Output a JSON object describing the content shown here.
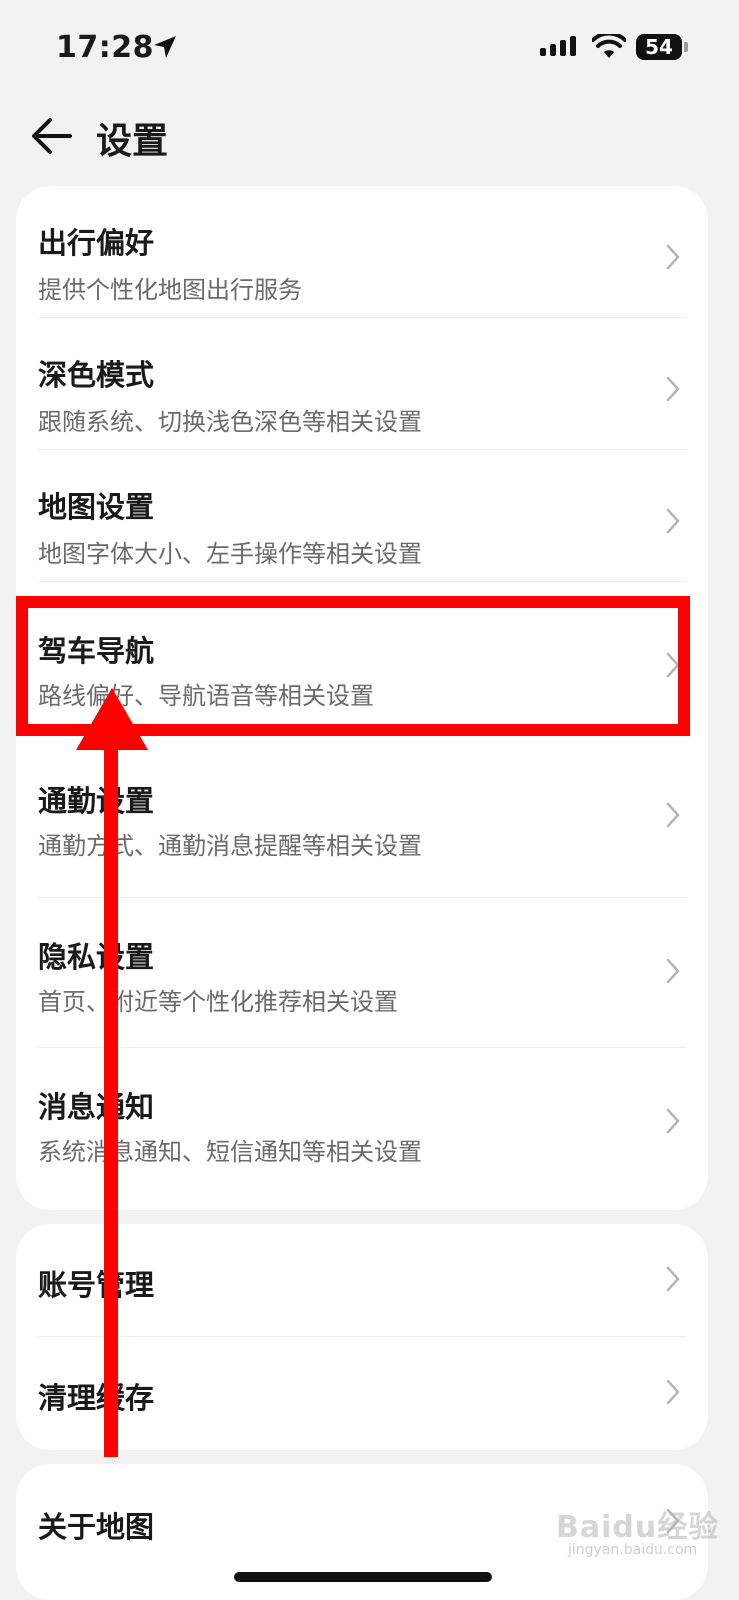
{
  "status_bar": {
    "time": "17:28",
    "battery": "54",
    "location_icon": "location-arrow-icon",
    "signal_icon": "cellular-signal-icon",
    "wifi_icon": "wifi-icon"
  },
  "header": {
    "title": "设置",
    "back_icon": "back-arrow-icon"
  },
  "groups": [
    {
      "items": [
        {
          "title": "出行偏好",
          "subtitle": "提供个性化地图出行服务"
        },
        {
          "title": "深色模式",
          "subtitle": "跟随系统、切换浅色深色等相关设置"
        },
        {
          "title": "地图设置",
          "subtitle": "地图字体大小、左手操作等相关设置"
        },
        {
          "title": "驾车导航",
          "subtitle": "路线偏好、导航语音等相关设置"
        },
        {
          "title": "通勤设置",
          "subtitle": "通勤方式、通勤消息提醒等相关设置"
        },
        {
          "title": "隐私设置",
          "subtitle": "首页、附近等个性化推荐相关设置"
        },
        {
          "title": "消息通知",
          "subtitle": "系统消息通知、短信通知等相关设置"
        }
      ]
    },
    {
      "items": [
        {
          "title": "账号管理"
        },
        {
          "title": "清理缓存"
        }
      ]
    },
    {
      "items": [
        {
          "title": "关于地图"
        }
      ]
    }
  ],
  "annotation": {
    "highlighted_item": "驾车导航",
    "color": "#ff0000"
  },
  "watermark": {
    "text": "Baidu经验",
    "sub": "jingyan.baidu.com"
  },
  "colors": {
    "background": "#f2f2f2",
    "card": "#ffffff",
    "subtitle": "#6b6b6b",
    "chevron": "#b5b5b5"
  }
}
